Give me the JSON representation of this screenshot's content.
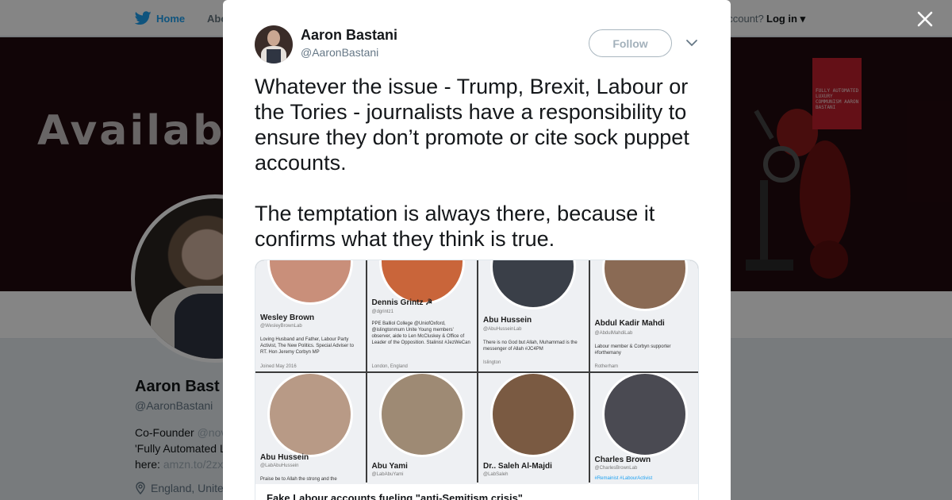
{
  "nav": {
    "home_label": "Home",
    "about_label": "Abo",
    "account_text": "account?",
    "login_label": "Log in"
  },
  "banner": {
    "text": "Available",
    "book_text": "FULLY AUTOMATED LUXURY COMMUNISM AARON BASTANI"
  },
  "profile": {
    "name": "Aaron Bast",
    "handle": "@AaronBastani",
    "bio_line1": "Co-Founder",
    "bio_link1": "@nov",
    "bio_line2": "'Fully Automated L",
    "bio_line3": "here:",
    "bio_link3": "amzn.to/2zx",
    "location": "England, Unite"
  },
  "tweet": {
    "author_name": "Aaron Bastani",
    "author_handle": "@AaronBastani",
    "follow_label": "Follow",
    "text": "Whatever the issue - Trump, Brexit, Labour or the Tories - journalists have a responsibility to ensure they don’t promote or cite sock puppet accounts.\n\nThe temptation is always there, because it confirms what they think is true."
  },
  "card": {
    "title": "Fake Labour accounts fueling \"anti-Semitism crisis\"",
    "accounts": [
      {
        "name": "Wesley Brown",
        "handle": "@WesleyBrownLab",
        "bio": "Loving Husband and Father, Labour Party Activist, The New Politics. Special Adviser to RT. Hon Jeremy Corbyn MP",
        "meta": "Joined May 2016",
        "pic_color": "#c98f7a"
      },
      {
        "name": "Dennis Grintz ☭",
        "handle": "@dgrintz1",
        "bio": "PPE Balliol College @UniofOxford, @islingtonmum Unite Young members' observer, aide to Len McCluskey & Office of Leader of the Opposition. Stalinist #JezWeCan",
        "meta": "London, England",
        "pic_color": "#c9653a"
      },
      {
        "name": "Abu Hussein",
        "handle": "@AbuHusseinLab",
        "bio": "There is no God but Allah, Muhammad is the messenger of Allah #JC4PM",
        "meta": "Islington",
        "pic_color": "#3a3f48"
      },
      {
        "name": "Abdul Kadir Mahdi",
        "handle": "@AbdulMahdiLab",
        "bio": "Labour member & Corbyn supporter #forthemany",
        "meta": "Rotherham",
        "pic_color": "#8a6a54"
      },
      {
        "name": "Abu Hussein",
        "handle": "@LabAbuHussein",
        "bio": "Praise be to Allah the strong and the",
        "meta": "",
        "pic_color": "#b89a86"
      },
      {
        "name": "Abu Yami",
        "handle": "@LabAbuYami",
        "bio": "",
        "meta": "",
        "pic_color": "#9e8a74"
      },
      {
        "name": "Dr.. Saleh Al-Majdi",
        "handle": "@LabSaleh",
        "bio": "",
        "meta": "",
        "pic_color": "#7a5a42"
      },
      {
        "name": "Charles Brown",
        "handle": "@CharlesBrownLab",
        "bio": "#Remainist #LabourActivist",
        "meta": "",
        "pic_color": "#4a4a52"
      }
    ]
  },
  "colors": {
    "twitter_blue": "#1da1f2",
    "text_primary": "#14171a",
    "text_secondary": "#657786",
    "overlay": "rgba(0,0,0,0.48)"
  }
}
